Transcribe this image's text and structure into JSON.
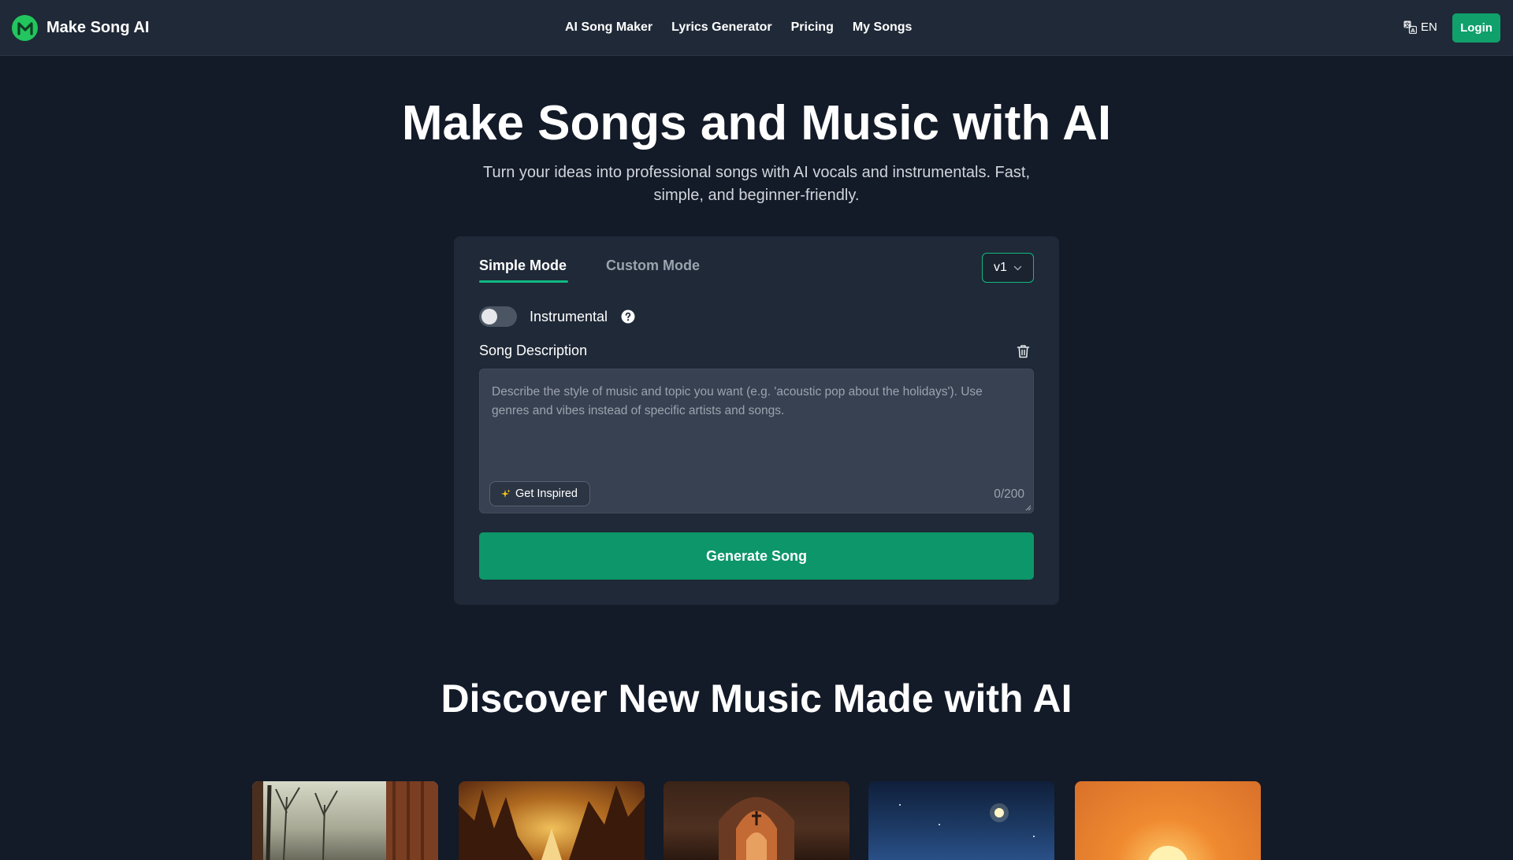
{
  "header": {
    "brand_name": "Make Song AI",
    "brand_letter": "M",
    "nav": [
      "AI Song Maker",
      "Lyrics Generator",
      "Pricing",
      "My Songs"
    ],
    "language": "EN",
    "login_label": "Login"
  },
  "hero": {
    "title": "Make Songs and Music with AI",
    "subtitle": "Turn your ideas into professional songs with AI vocals and instrumentals. Fast, simple, and beginner-friendly."
  },
  "generator": {
    "tabs": [
      "Simple Mode",
      "Custom Mode"
    ],
    "active_tab": "Simple Mode",
    "version": "v1",
    "instrumental_label": "Instrumental",
    "instrumental_on": false,
    "description_label": "Song Description",
    "description_value": "",
    "description_placeholder": "Describe the style of music and topic you want (e.g. 'acoustic pop about the holidays'). Use genres and vibes instead of specific artists and songs.",
    "get_inspired_label": "Get Inspired",
    "char_counter": "0/200",
    "generate_label": "Generate Song"
  },
  "discover": {
    "title": "Discover New Music Made with AI"
  },
  "colors": {
    "background": "#131a28",
    "header": "#1f2937",
    "accent": "#10b981",
    "generate_button": "#0c9669",
    "login_button": "#10a06b"
  },
  "icons": [
    "brand-logo-icon",
    "language-icon",
    "chevron-down-icon",
    "help-circle-icon",
    "trash-icon",
    "sparkle-icon"
  ]
}
